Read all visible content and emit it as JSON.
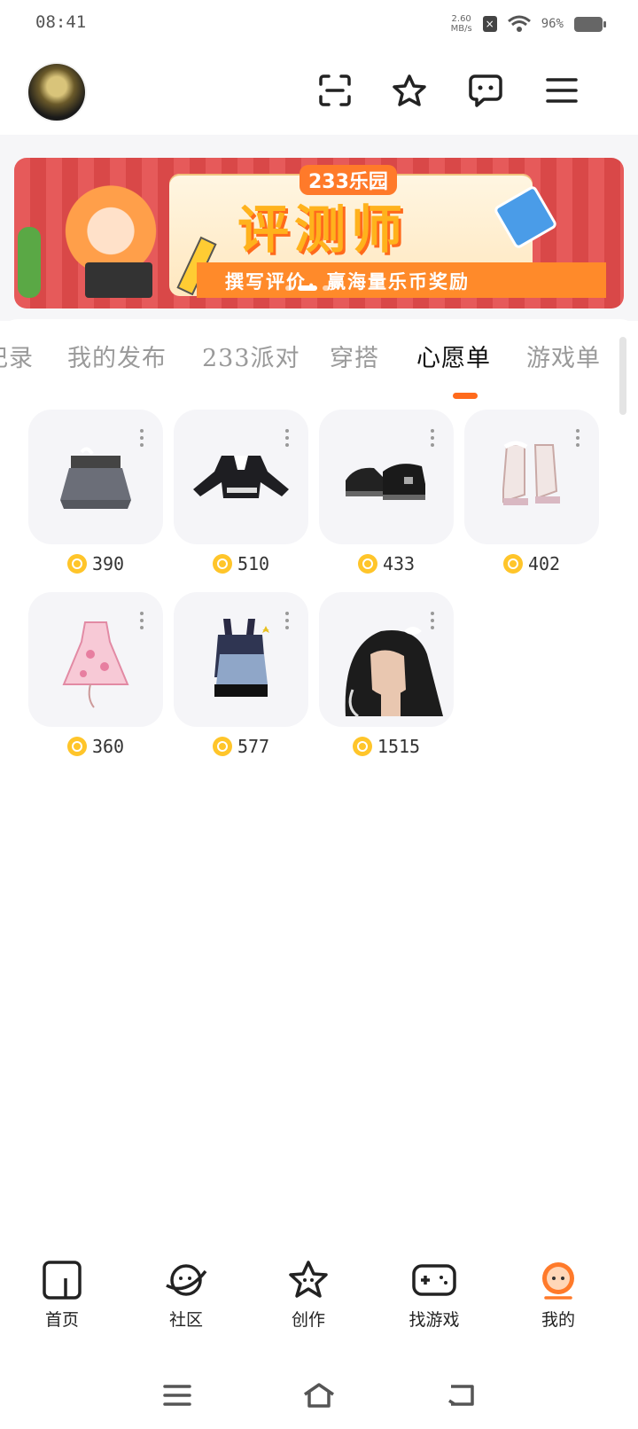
{
  "status": {
    "time": "08:41",
    "net_speed": "2.60",
    "net_unit": "MB/s",
    "battery": "96%"
  },
  "banner": {
    "brand": "233乐园",
    "title": "评测师",
    "subtitle": "撰写评价，赢海量乐币奖励",
    "active_slide": 2,
    "slides": 3
  },
  "tabs": [
    {
      "label": "记录"
    },
    {
      "label": "我的发布"
    },
    {
      "label": "233派对"
    },
    {
      "label": "穿搭"
    },
    {
      "label": "心愿单"
    },
    {
      "label": "游戏单"
    }
  ],
  "wishlist": [
    {
      "name": "grey-pleated-skirt",
      "price": "390"
    },
    {
      "name": "black-crop-jacket",
      "price": "510"
    },
    {
      "name": "black-platform-shoes",
      "price": "433"
    },
    {
      "name": "cream-ruffle-boots",
      "price": "402"
    },
    {
      "name": "pink-floral-dress",
      "price": "360"
    },
    {
      "name": "bunny-denim-outfit",
      "price": "577"
    },
    {
      "name": "black-ponytail-hair",
      "price": "1515"
    }
  ],
  "bottom_nav": [
    {
      "label": "首页",
      "icon": "home-icon"
    },
    {
      "label": "社区",
      "icon": "planet-icon"
    },
    {
      "label": "创作",
      "icon": "star-icon"
    },
    {
      "label": "找游戏",
      "icon": "gamepad-icon"
    },
    {
      "label": "我的",
      "icon": "profile-icon"
    }
  ],
  "colors": {
    "accent": "#ff6a1c",
    "coin": "#ffc52a"
  }
}
